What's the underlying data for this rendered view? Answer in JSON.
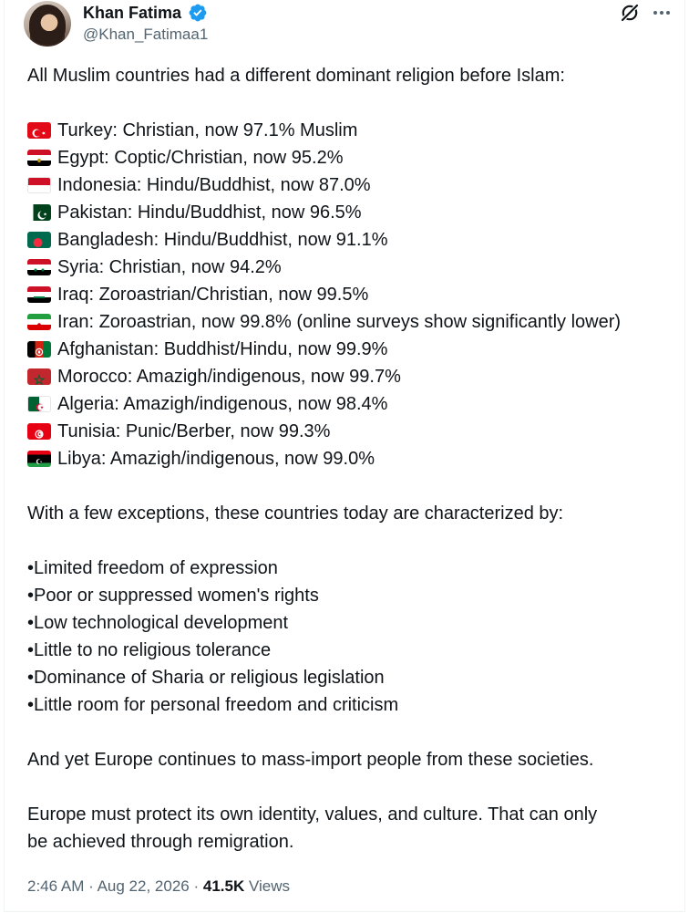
{
  "author": {
    "name": "Khan Fatima",
    "handle": "@Khan_Fatimaa1",
    "verified": true
  },
  "colors": {
    "verified_badge": "#1d9bf0",
    "text_primary": "#0f1419",
    "text_secondary": "#536471"
  },
  "icons": {
    "grok": "grok-icon",
    "more": "more-options-icon",
    "verified": "verified-badge-icon"
  },
  "tweet": {
    "intro": "All Muslim countries had a different dominant religion before Islam:",
    "countries": [
      {
        "flag": "turkey",
        "text": "Turkey: Christian, now 97.1% Muslim"
      },
      {
        "flag": "egypt",
        "text": "Egypt: Coptic/Christian, now 95.2%"
      },
      {
        "flag": "indonesia",
        "text": "Indonesia: Hindu/Buddhist, now 87.0%"
      },
      {
        "flag": "pakistan",
        "text": "Pakistan: Hindu/Buddhist, now 96.5%"
      },
      {
        "flag": "bangladesh",
        "text": "Bangladesh: Hindu/Buddhist, now 91.1%"
      },
      {
        "flag": "syria",
        "text": "Syria: Christian, now 94.2%"
      },
      {
        "flag": "iraq",
        "text": "Iraq: Zoroastrian/Christian, now 99.5%"
      },
      {
        "flag": "iran",
        "text": "Iran: Zoroastrian, now 99.8% (online surveys show significantly lower)"
      },
      {
        "flag": "afghanistan",
        "text": "Afghanistan: Buddhist/Hindu, now 99.9%"
      },
      {
        "flag": "morocco",
        "text": "Morocco: Amazigh/indigenous, now 99.7%"
      },
      {
        "flag": "algeria",
        "text": "Algeria: Amazigh/indigenous, now 98.4%"
      },
      {
        "flag": "tunisia",
        "text": "Tunisia: Punic/Berber, now 99.3%"
      },
      {
        "flag": "libya",
        "text": "Libya: Amazigh/indigenous, now 99.0%"
      }
    ],
    "exceptions_intro": "With a few exceptions, these countries today are characterized by:",
    "bullets": [
      "•Limited freedom of expression",
      "•Poor or suppressed women's rights",
      "•Low technological development",
      "•Little to no religious tolerance",
      "•Dominance of Sharia or religious legislation",
      "•Little room for personal freedom and criticism"
    ],
    "europe_line": "And yet Europe continues to mass-import people from these societies.",
    "closing_1": "Europe must protect its own identity, values, and culture. That can only",
    "closing_2": "be achieved through remigration."
  },
  "meta": {
    "time": "2:46 AM",
    "separator": "·",
    "date": "Aug 22, 2026",
    "views_count": "41.5K",
    "views_label": "Views"
  }
}
